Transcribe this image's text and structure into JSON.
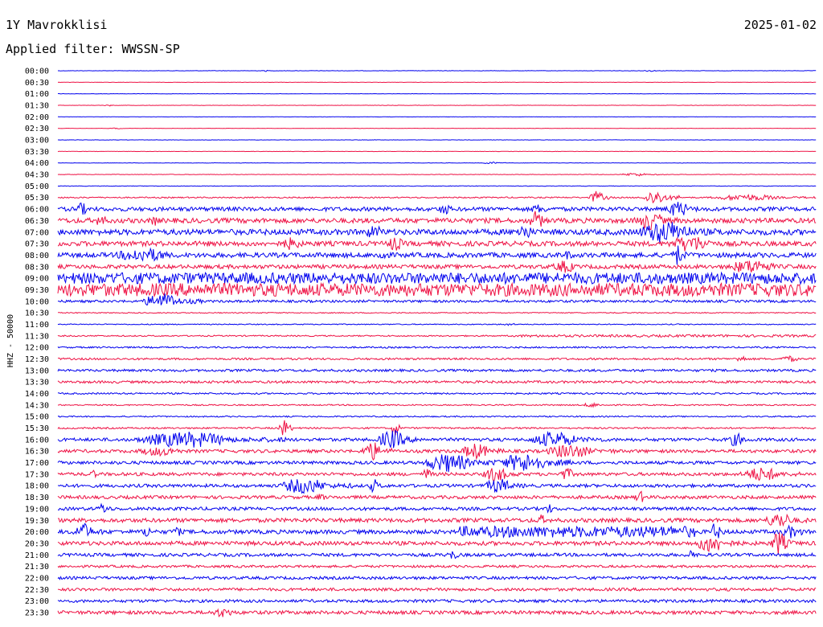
{
  "header": {
    "station": "1Y Mavrokklisi",
    "date": "2025-01-02",
    "filter_label": "Applied filter: WWSSN-SP"
  },
  "chart_data": {
    "type": "line",
    "title": "1Y Mavrokklisi",
    "subtitle": "Applied filter: WWSSN-SP",
    "date": "2025-01-02",
    "ylabel": "HHZ - 50000",
    "xlabel": "",
    "row_labels": [
      "00:00",
      "00:30",
      "01:00",
      "01:30",
      "02:00",
      "02:30",
      "03:00",
      "03:30",
      "04:00",
      "04:30",
      "05:00",
      "05:30",
      "06:00",
      "06:30",
      "07:00",
      "07:30",
      "08:00",
      "08:30",
      "09:00",
      "09:30",
      "10:00",
      "10:30",
      "11:00",
      "11:30",
      "12:00",
      "12:30",
      "13:00",
      "13:30",
      "14:00",
      "14:30",
      "15:00",
      "15:30",
      "16:00",
      "16:30",
      "17:00",
      "17:30",
      "18:00",
      "18:30",
      "19:00",
      "19:30",
      "20:00",
      "20:30",
      "21:00",
      "21:30",
      "22:00",
      "22:30",
      "23:00",
      "23:30"
    ],
    "trace_colors": [
      "#0000ee",
      "#ee1144"
    ],
    "noise_levels": [
      0.2,
      0.2,
      0.2,
      0.2,
      0.2,
      0.2,
      0.2,
      0.2,
      0.25,
      0.3,
      0.3,
      0.8,
      2.5,
      3,
      3.5,
      3,
      3,
      2.5,
      5,
      6,
      1.5,
      0.6,
      0.6,
      0.8,
      1,
      1.2,
      1.5,
      1.5,
      1,
      0.8,
      0.8,
      1,
      2,
      2,
      2,
      2,
      2,
      2,
      2,
      2.5,
      2.5,
      2.5,
      2,
      1.5,
      1.8,
      1.8,
      1.8,
      2.2
    ],
    "bursts": [
      {
        "row": 0,
        "at": 0.27,
        "len": 0.01,
        "amp": 1
      },
      {
        "row": 0,
        "at": 0.77,
        "len": 0.03,
        "amp": 1
      },
      {
        "row": 3,
        "at": 0.06,
        "len": 0.02,
        "amp": 1
      },
      {
        "row": 5,
        "at": 0.07,
        "len": 0.02,
        "amp": 1
      },
      {
        "row": 8,
        "at": 0.56,
        "len": 0.03,
        "amp": 1.5
      },
      {
        "row": 9,
        "at": 0.74,
        "len": 0.06,
        "amp": 2
      },
      {
        "row": 11,
        "at": 0.7,
        "len": 0.03,
        "amp": 8
      },
      {
        "row": 11,
        "at": 0.77,
        "len": 0.05,
        "amp": 9
      },
      {
        "row": 11,
        "at": 0.86,
        "len": 0.14,
        "amp": 4
      },
      {
        "row": 12,
        "at": 0.02,
        "len": 0.03,
        "amp": 8
      },
      {
        "row": 12,
        "at": 0.5,
        "len": 0.03,
        "amp": 7
      },
      {
        "row": 12,
        "at": 0.62,
        "len": 0.04,
        "amp": 6
      },
      {
        "row": 12,
        "at": 0.8,
        "len": 0.05,
        "amp": 10
      },
      {
        "row": 13,
        "at": 0.05,
        "len": 0.02,
        "amp": 10
      },
      {
        "row": 13,
        "at": 0.12,
        "len": 0.02,
        "amp": 7
      },
      {
        "row": 13,
        "at": 0.62,
        "len": 0.03,
        "amp": 12
      },
      {
        "row": 13,
        "at": 0.76,
        "len": 0.06,
        "amp": 12
      },
      {
        "row": 14,
        "at": 0.4,
        "len": 0.05,
        "amp": 8
      },
      {
        "row": 14,
        "at": 0.6,
        "len": 0.04,
        "amp": 10
      },
      {
        "row": 14,
        "at": 0.76,
        "len": 0.12,
        "amp": 14
      },
      {
        "row": 15,
        "at": 0.29,
        "len": 0.05,
        "amp": 8
      },
      {
        "row": 15,
        "at": 0.43,
        "len": 0.04,
        "amp": 9
      },
      {
        "row": 15,
        "at": 0.8,
        "len": 0.1,
        "amp": 10
      },
      {
        "row": 16,
        "at": 0.07,
        "len": 0.12,
        "amp": 9
      },
      {
        "row": 16,
        "at": 0.42,
        "len": 0.02,
        "amp": 10
      },
      {
        "row": 16,
        "at": 0.66,
        "len": 0.03,
        "amp": 6
      },
      {
        "row": 16,
        "at": 0.81,
        "len": 0.02,
        "amp": 14
      },
      {
        "row": 17,
        "at": 0.65,
        "len": 0.05,
        "amp": 8
      },
      {
        "row": 17,
        "at": 0.88,
        "len": 0.1,
        "amp": 9
      },
      {
        "row": 18,
        "at": 0.01,
        "len": 0.99,
        "amp": 7
      },
      {
        "row": 19,
        "at": 0.01,
        "len": 0.99,
        "amp": 8
      },
      {
        "row": 20,
        "at": 0.11,
        "len": 0.08,
        "amp": 10
      },
      {
        "row": 22,
        "at": 0.58,
        "len": 0.04,
        "amp": 1.5
      },
      {
        "row": 23,
        "at": 0.6,
        "len": 0.4,
        "amp": 1.5
      },
      {
        "row": 25,
        "at": 0.89,
        "len": 0.03,
        "amp": 4
      },
      {
        "row": 25,
        "at": 0.95,
        "len": 0.04,
        "amp": 4
      },
      {
        "row": 29,
        "at": 0.69,
        "len": 0.04,
        "amp": 3
      },
      {
        "row": 31,
        "at": 0.29,
        "len": 0.02,
        "amp": 12
      },
      {
        "row": 31,
        "at": 0.44,
        "len": 0.01,
        "amp": 18
      },
      {
        "row": 32,
        "at": 0.1,
        "len": 0.2,
        "amp": 10
      },
      {
        "row": 32,
        "at": 0.42,
        "len": 0.06,
        "amp": 12
      },
      {
        "row": 32,
        "at": 0.62,
        "len": 0.1,
        "amp": 10
      },
      {
        "row": 32,
        "at": 0.88,
        "len": 0.04,
        "amp": 8
      },
      {
        "row": 33,
        "at": 0.1,
        "len": 0.1,
        "amp": 6
      },
      {
        "row": 33,
        "at": 0.4,
        "len": 0.04,
        "amp": 12
      },
      {
        "row": 33,
        "at": 0.53,
        "len": 0.06,
        "amp": 10
      },
      {
        "row": 33,
        "at": 0.64,
        "len": 0.1,
        "amp": 9
      },
      {
        "row": 34,
        "at": 0.48,
        "len": 0.1,
        "amp": 12
      },
      {
        "row": 34,
        "at": 0.58,
        "len": 0.1,
        "amp": 12
      },
      {
        "row": 35,
        "at": 0.04,
        "len": 0.02,
        "amp": 5
      },
      {
        "row": 35,
        "at": 0.48,
        "len": 0.02,
        "amp": 8
      },
      {
        "row": 35,
        "at": 0.56,
        "len": 0.05,
        "amp": 10
      },
      {
        "row": 35,
        "at": 0.66,
        "len": 0.03,
        "amp": 8
      },
      {
        "row": 35,
        "at": 0.9,
        "len": 0.08,
        "amp": 9
      },
      {
        "row": 36,
        "at": 0.29,
        "len": 0.1,
        "amp": 10
      },
      {
        "row": 36,
        "at": 0.41,
        "len": 0.02,
        "amp": 9
      },
      {
        "row": 36,
        "at": 0.56,
        "len": 0.06,
        "amp": 9
      },
      {
        "row": 37,
        "at": 0.34,
        "len": 0.02,
        "amp": 5
      },
      {
        "row": 37,
        "at": 0.76,
        "len": 0.02,
        "amp": 8
      },
      {
        "row": 38,
        "at": 0.05,
        "len": 0.03,
        "amp": 7
      },
      {
        "row": 38,
        "at": 0.64,
        "len": 0.02,
        "amp": 6
      },
      {
        "row": 39,
        "at": 0.63,
        "len": 0.02,
        "amp": 7
      },
      {
        "row": 39,
        "at": 0.93,
        "len": 0.06,
        "amp": 10
      },
      {
        "row": 40,
        "at": 0.02,
        "len": 0.04,
        "amp": 11
      },
      {
        "row": 40,
        "at": 0.11,
        "len": 0.02,
        "amp": 8
      },
      {
        "row": 40,
        "at": 0.15,
        "len": 0.02,
        "amp": 7
      },
      {
        "row": 40,
        "at": 0.53,
        "len": 0.31,
        "amp": 7
      },
      {
        "row": 40,
        "at": 0.86,
        "len": 0.02,
        "amp": 12
      },
      {
        "row": 40,
        "at": 0.95,
        "len": 0.05,
        "amp": 8
      },
      {
        "row": 41,
        "at": 0.84,
        "len": 0.06,
        "amp": 12
      },
      {
        "row": 41,
        "at": 0.94,
        "len": 0.03,
        "amp": 16
      },
      {
        "row": 42,
        "at": 0.51,
        "len": 0.03,
        "amp": 6
      },
      {
        "row": 42,
        "at": 0.83,
        "len": 0.01,
        "amp": 10
      },
      {
        "row": 47,
        "at": 0.2,
        "len": 0.05,
        "amp": 6
      }
    ]
  }
}
